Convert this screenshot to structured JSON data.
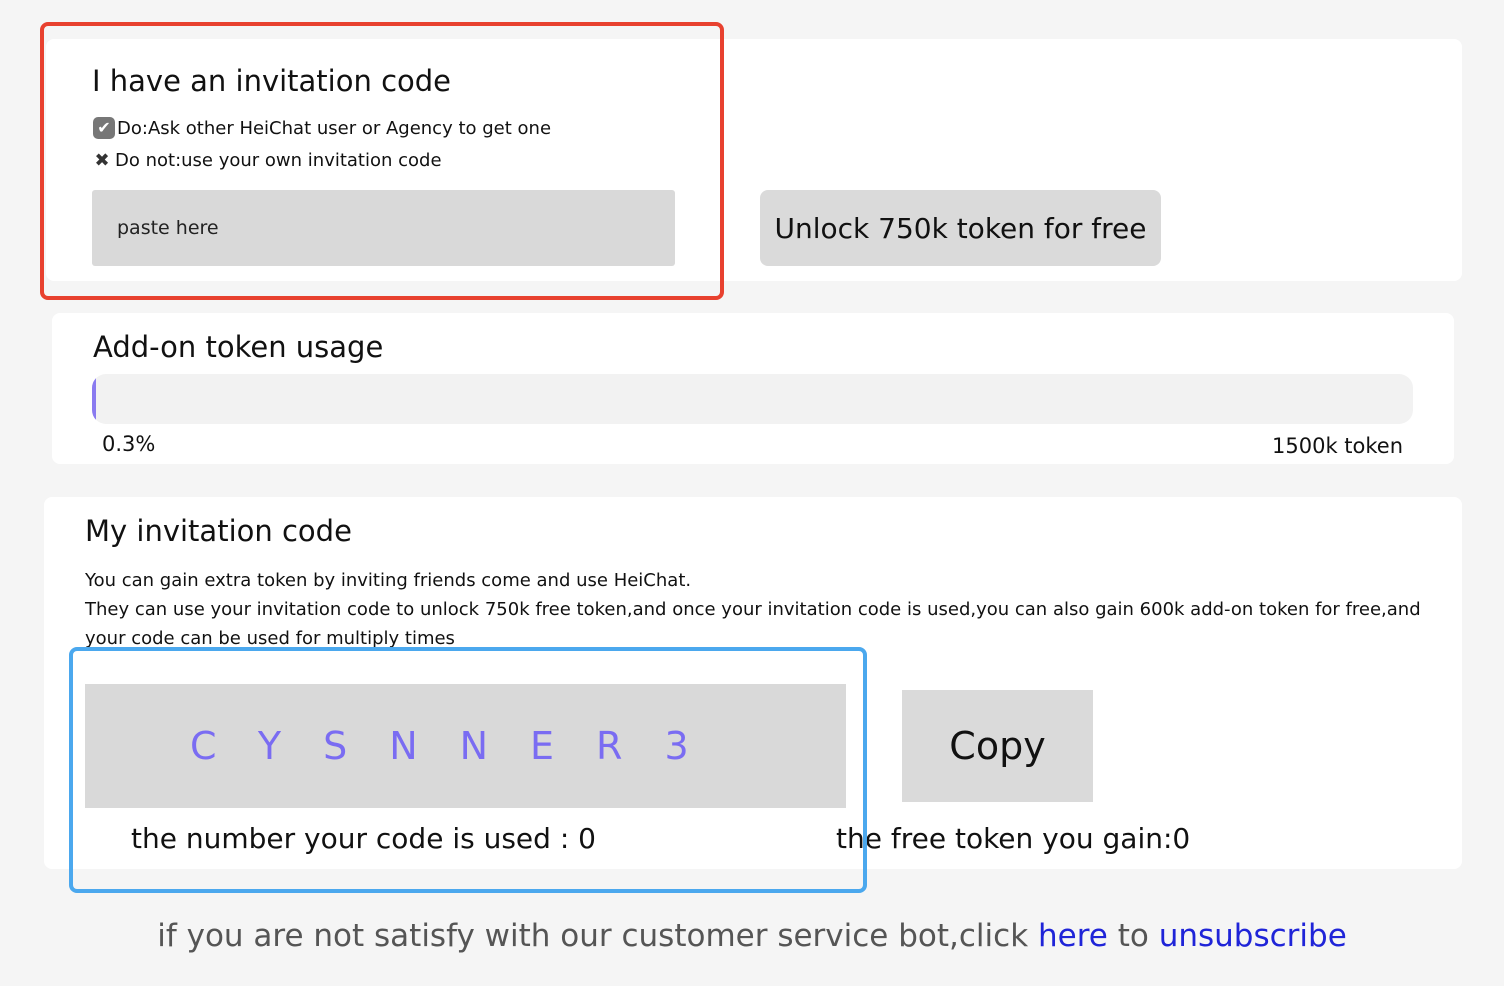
{
  "invite": {
    "title": "I have an invitation code",
    "do_rule": "Do:Ask other HeiChat user or Agency to get one",
    "dont_rule": "Do not:use your own invitation code",
    "input_placeholder": "paste here",
    "unlock_label": "Unlock 750k token for free"
  },
  "usage": {
    "title": "Add-on token usage",
    "percent_label": "0.3%",
    "fraction": 0.003,
    "total_label": "1500k token"
  },
  "mycode": {
    "title": "My invitation code",
    "desc_1": "You can gain extra token by inviting friends come and use HeiChat.",
    "desc_2": "They can use your invitation code to unlock 750k free token,and once your invitation code is used,you can also gain 600k add-on token for free,and",
    "desc_3": "your code can be used for multiply times",
    "code": "CYSNNER3",
    "copy_label": "Copy",
    "used_label": "the number your code is used : 0",
    "gain_label": "the free token you gain:0"
  },
  "footer": {
    "prefix": "if you are not satisfy with our customer service bot,click ",
    "here_link": "here",
    "middle": " to ",
    "unsubscribe_link": "unsubscribe"
  },
  "colors": {
    "highlight_red": "#e8412f",
    "highlight_blue": "#4ba8ee",
    "code_purple": "#7a6cf2",
    "link_blue": "#1f24d8"
  },
  "icons": {
    "do": "check-icon",
    "dont": "x-icon"
  }
}
